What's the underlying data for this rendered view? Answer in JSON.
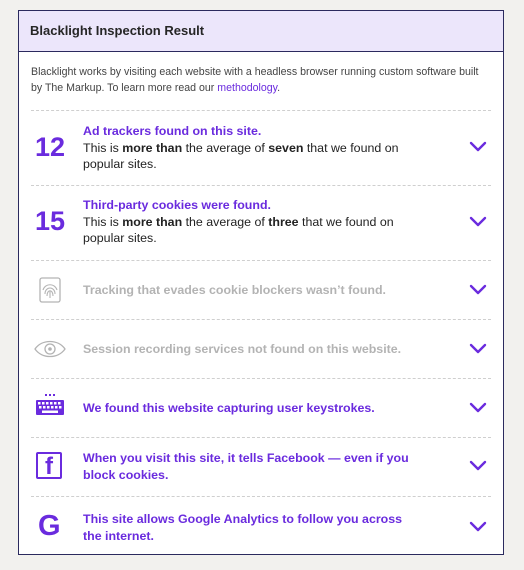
{
  "header": {
    "title": "Blacklight Inspection Result"
  },
  "intro": {
    "text": "Blacklight works by visiting each website with a headless browser running custom software built by The Markup. To learn more read our ",
    "link": "methodology",
    "suffix": "."
  },
  "rows": [
    {
      "number": "12",
      "headline": "Ad trackers found on this site.",
      "detail_pre": "This is ",
      "detail_bold1": "more than",
      "detail_mid": " the average of ",
      "detail_bold2": "seven",
      "detail_post": " that we found on popular sites."
    },
    {
      "number": "15",
      "headline": "Third-party cookies were found.",
      "detail_pre": "This is ",
      "detail_bold1": "more than",
      "detail_mid": " the average of ",
      "detail_bold2": "three",
      "detail_post": " that we found on popular sites."
    },
    {
      "icon": "fingerprint-icon",
      "text": "Tracking that evades cookie blockers wasn’t found."
    },
    {
      "icon": "eye-icon",
      "text": "Session recording services not found on this website."
    },
    {
      "icon": "keyboard-icon",
      "text": "We found this website capturing user keystrokes."
    },
    {
      "icon": "facebook-icon",
      "text": "When you visit this site, it tells Facebook — even if you block cookies.",
      "glyph": "f"
    },
    {
      "icon": "google-icon",
      "text": "This site allows Google Analytics to follow you across the internet.",
      "glyph": "G"
    }
  ],
  "colors": {
    "accent": "#6a2bde",
    "muted": "#b3b3b3",
    "header_bg": "#ece6fb",
    "border": "#2b2a5e"
  }
}
